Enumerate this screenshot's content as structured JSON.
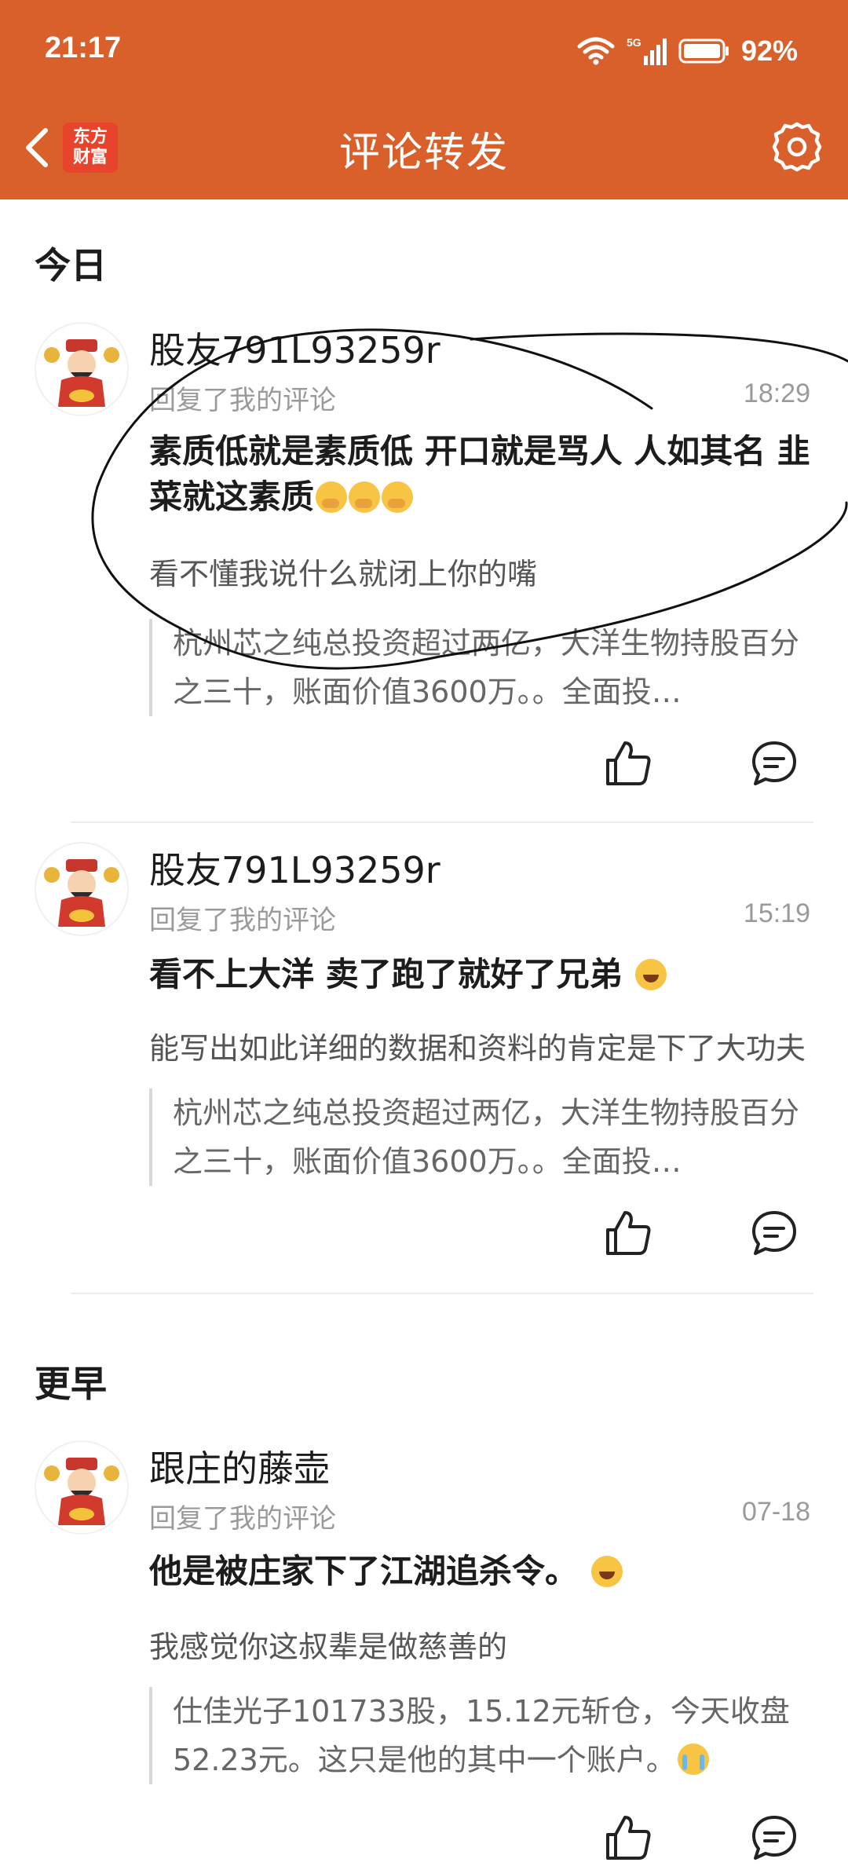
{
  "status_bar": {
    "time": "21:17",
    "network": "5G",
    "battery": "92%"
  },
  "header": {
    "logo_line1": "东方",
    "logo_line2": "财富",
    "title": "评论转发"
  },
  "sections": {
    "today": "今日",
    "earlier": "更早"
  },
  "items": [
    {
      "username": "股友791L93259r",
      "action": "回复了我的评论",
      "time": "18:29",
      "text": "素质低就是素质低 开口就是骂人 人如其名 韭菜就这素质",
      "reply": "看不懂我说什么就闭上你的嘴",
      "quote": "杭州芯之纯总投资超过两亿，大洋生物持股百分之三十，账面价值3600万。。全面投…"
    },
    {
      "username": "股友791L93259r",
      "action": "回复了我的评论",
      "time": "15:19",
      "text": "看不上大洋 卖了跑了就好了兄弟",
      "reply": "能写出如此详细的数据和资料的肯定是下了大功夫",
      "quote": "杭州芯之纯总投资超过两亿，大洋生物持股百分之三十，账面价值3600万。。全面投…"
    },
    {
      "username": "跟庄的藤壶",
      "action": "回复了我的评论",
      "time": "07-18",
      "text": "他是被庄家下了江湖追杀令。",
      "reply": "我感觉你这叔辈是做慈善的",
      "quote": "仕佳光子101733股，15.12元斩仓，今天收盘52.23元。这只是他的其中一个账户。"
    }
  ],
  "colors": {
    "header_bg": "#d9602a",
    "annotation_stroke": "#111111"
  }
}
